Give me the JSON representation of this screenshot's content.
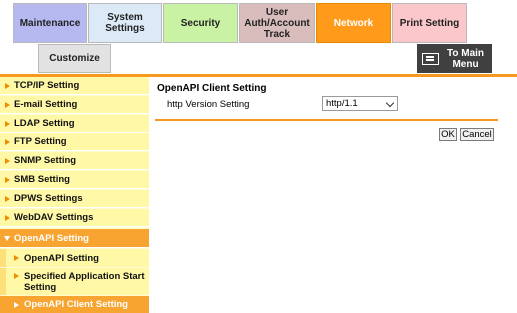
{
  "tabs": {
    "maintenance": "Maintenance",
    "system_settings": "System Settings",
    "security": "Security",
    "user_auth_line1": "User",
    "user_auth_line2": "Auth/Account",
    "user_auth_line3": "Track",
    "network": "Network",
    "print_setting": "Print Setting",
    "customize": "Customize"
  },
  "to_main_menu": {
    "line1": "To Main",
    "line2": "Menu",
    "icon": "monitor-icon"
  },
  "sidebar": {
    "items": [
      {
        "label": "TCP/IP Setting"
      },
      {
        "label": "E-mail Setting"
      },
      {
        "label": "LDAP Setting"
      },
      {
        "label": "FTP Setting"
      },
      {
        "label": "SNMP Setting"
      },
      {
        "label": "SMB Setting"
      },
      {
        "label": "DPWS Settings"
      },
      {
        "label": "WebDAV Settings"
      },
      {
        "label": "OpenAPI Setting"
      }
    ],
    "subitems": [
      {
        "label": "OpenAPI Setting"
      },
      {
        "label_line1": "Specified Application Start",
        "label_line2": "Setting"
      },
      {
        "label": "OpenAPI Client Setting"
      }
    ]
  },
  "main": {
    "title": "OpenAPI Client Setting",
    "http_version_label": "http Version Setting",
    "http_version_value": "http/1.1",
    "ok_label": "OK",
    "cancel_label": "Cancel"
  },
  "colors": {
    "accent": "#f59a1e",
    "network_tab": "#ff9a1a",
    "sidebar_item": "#fff8a6"
  }
}
